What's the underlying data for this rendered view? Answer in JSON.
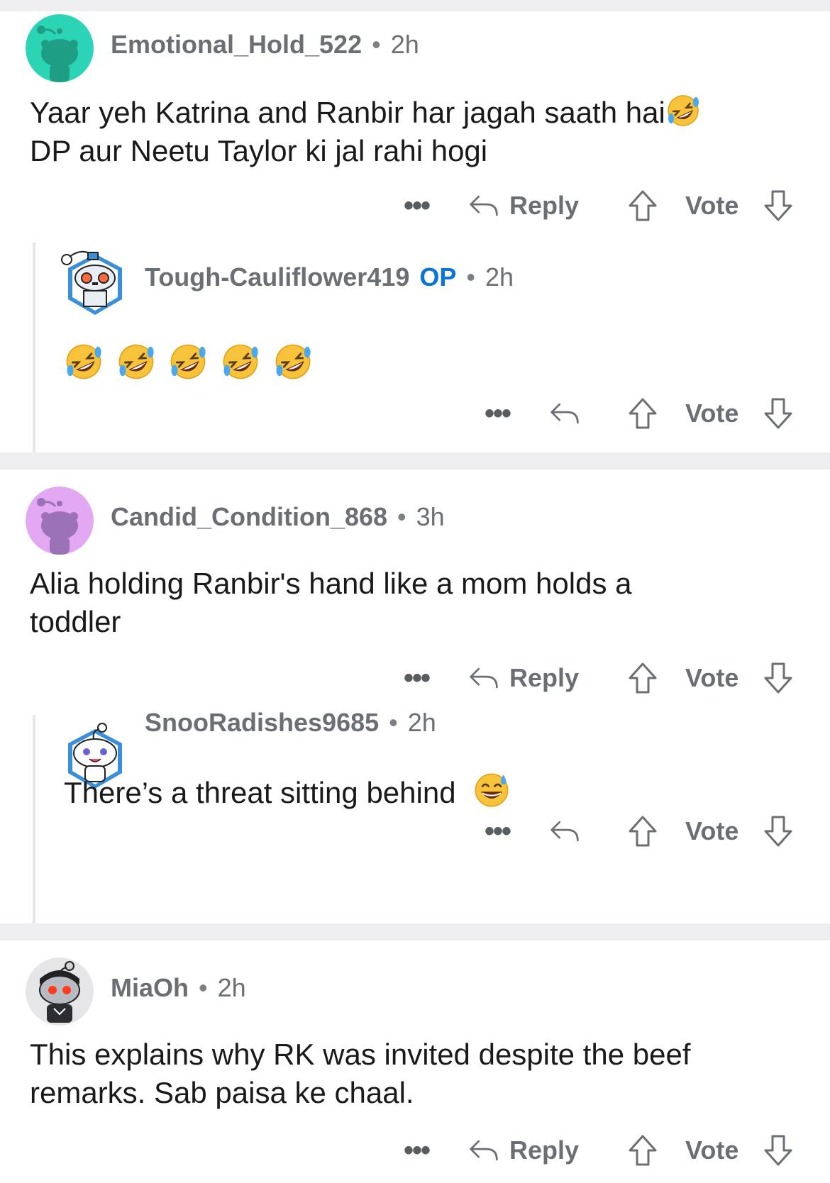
{
  "comments": [
    {
      "username": "Emotional_Hold_522",
      "time": "2h",
      "text_lines": [
        "Yaar yeh Katrina and Ranbir har jagah saath hai",
        "DP aur Neetu Taylor ki jal rahi hogi"
      ],
      "avatar_color": "#2bd4b4",
      "reply_label": "Reply",
      "vote_label": "Vote",
      "reply": {
        "username": "Tough-Cauliflower419",
        "op_badge": "OP",
        "time": "2h",
        "emoji_count": 5,
        "vote_label": "Vote"
      }
    },
    {
      "username": "Candid_Condition_868",
      "time": "3h",
      "text_lines": [
        "Alia holding Ranbir's hand like a mom holds a",
        "toddler"
      ],
      "avatar_color": "#e2a9f2",
      "reply_label": "Reply",
      "vote_label": "Vote",
      "reply": {
        "username": "SnooRadishes9685",
        "time": "2h",
        "text": "There’s a threat sitting behind",
        "vote_label": "Vote"
      }
    },
    {
      "username": "MiaOh",
      "time": "2h",
      "text_lines": [
        "This explains why RK was invited despite the beef",
        "remarks. Sab paisa ke chaal."
      ],
      "avatar_color": "#e6e6e8",
      "reply_label": "Reply",
      "vote_label": "Vote"
    }
  ],
  "separator": "•",
  "more_icon": "more-dots-icon",
  "colors": {
    "op": "#0a74d9",
    "meta_gray": "#6b6f73",
    "gap": "#efeff1"
  }
}
